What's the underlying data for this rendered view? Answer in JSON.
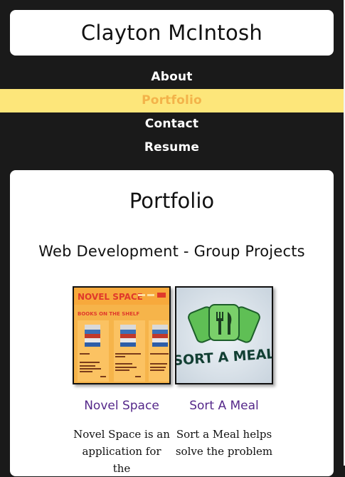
{
  "header": {
    "site_title": "Clayton McIntosh"
  },
  "nav": {
    "items": [
      {
        "label": "About"
      },
      {
        "label": "Portfolio",
        "active": true
      },
      {
        "label": "Contact"
      },
      {
        "label": "Resume"
      }
    ]
  },
  "main": {
    "page_title": "Portfolio",
    "section_title": "Web Development - Group Projects",
    "projects": [
      {
        "name": "Novel Space",
        "description": "Novel Space is an application for the",
        "thumbnail": {
          "brand_text": "NOVEL SPACE",
          "shelf_heading": "BOOKS ON THE SHELF"
        }
      },
      {
        "name": "Sort A Meal",
        "description": "Sort a Meal helps solve the problem",
        "thumbnail": {
          "logo_text": "SORT A MEAL"
        }
      }
    ]
  },
  "colors": {
    "background": "#1a1a1a",
    "nav_active_bg": "#fde67a",
    "nav_active_text": "#f3b34a",
    "project_link": "#55288a"
  }
}
